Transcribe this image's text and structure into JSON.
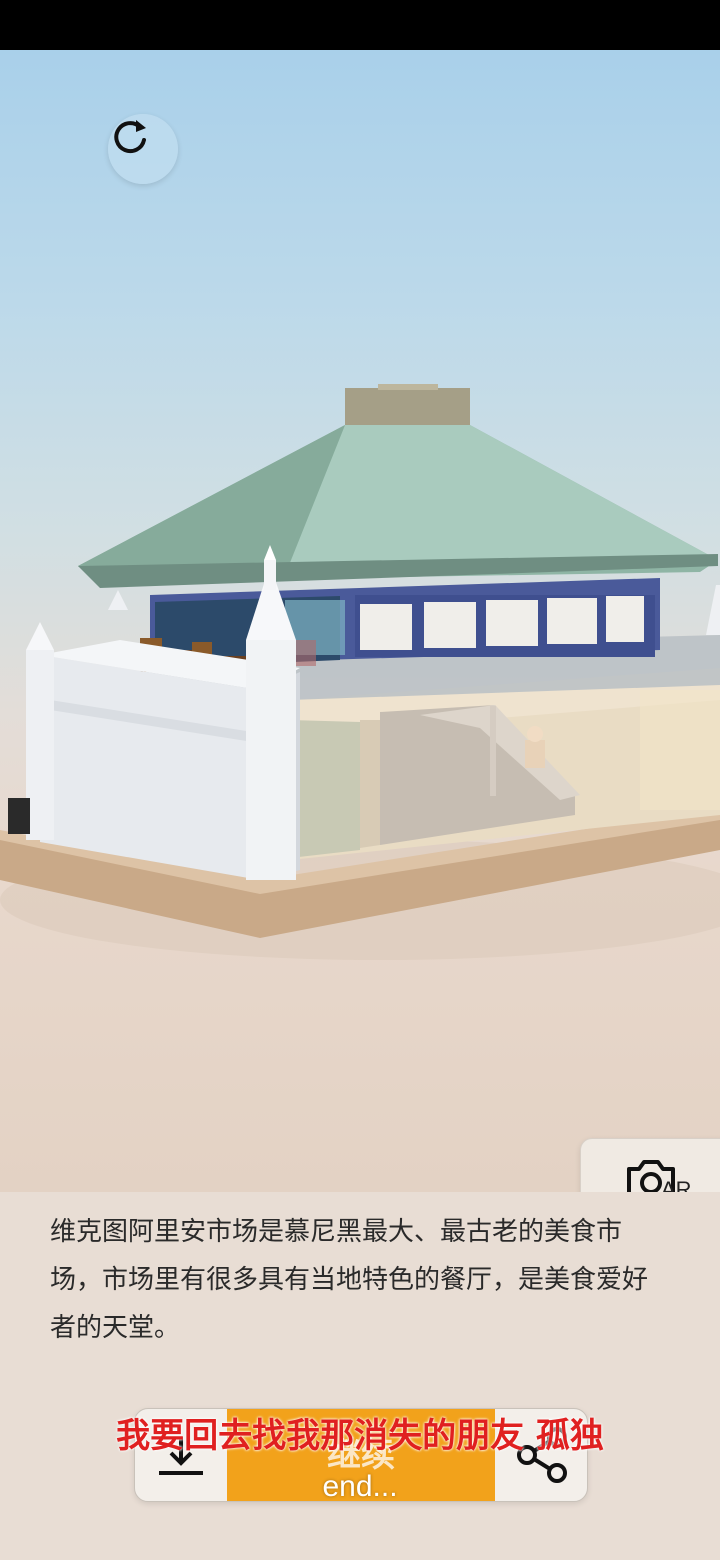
{
  "scene": {
    "description": "维克图阿里安市场是慕尼黑最大、最古老的美食市场，市场里有很多具有当地特色的餐厅，是美食爱好者的天堂。"
  },
  "controls": {
    "rotate_icon": "rotate-icon",
    "camera_icon": "camera-icon",
    "ar_label": "AR"
  },
  "toolbar": {
    "download_icon": "download-icon",
    "continue_label": "继续",
    "share_icon": "share-icon",
    "accent_color": "#f2a21b"
  },
  "overlay": {
    "subtitle": "我要回去找我那消失的朋友 孤独",
    "caption": "end..."
  }
}
